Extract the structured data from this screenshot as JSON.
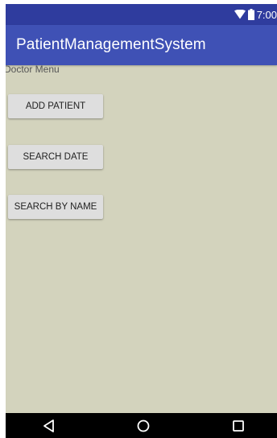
{
  "status_bar": {
    "time": "7:00",
    "icons": [
      "wifi-icon",
      "battery-icon"
    ]
  },
  "app_bar": {
    "title": "PatientManagementSystem"
  },
  "main": {
    "menu_label": "Doctor Menu",
    "buttons": [
      {
        "label": "ADD PATIENT"
      },
      {
        "label": "SEARCH DATE"
      },
      {
        "label": "SEARCH BY NAME"
      }
    ]
  },
  "nav_bar": {
    "icons": [
      "back-icon",
      "home-icon",
      "recents-icon"
    ]
  },
  "colors": {
    "status_bar": "#2f3c9e",
    "app_bar": "#3f51b5",
    "background": "#d3d3bd",
    "button": "#dedede",
    "nav_bar": "#000000"
  }
}
